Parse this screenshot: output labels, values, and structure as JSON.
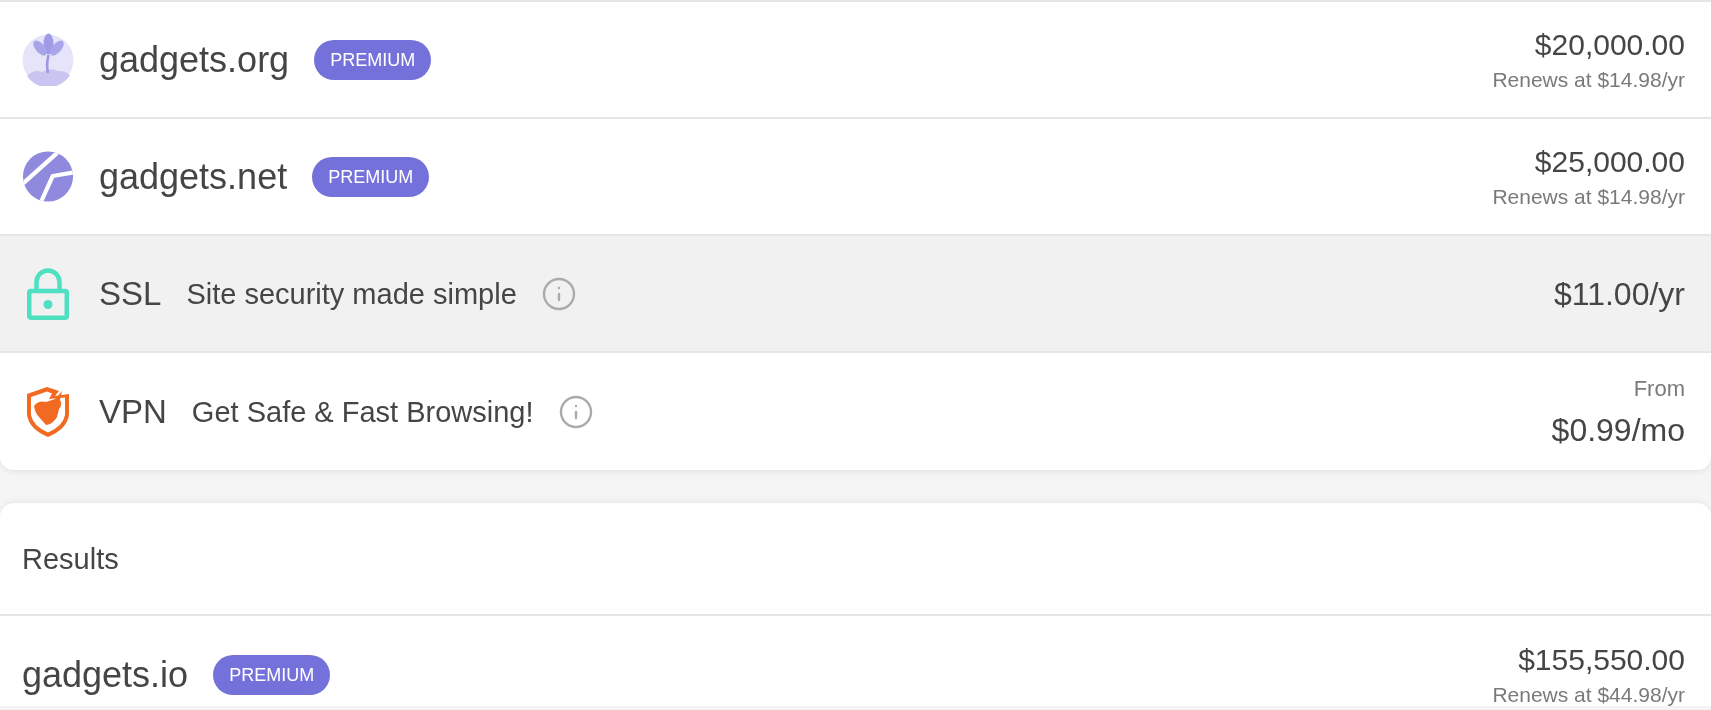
{
  "suggestions": [
    {
      "kind": "domain",
      "name": "gadgets.org",
      "badge": "PREMIUM",
      "price": "$20,000.00",
      "renewal": "Renews at $14.98/yr",
      "highlighted": false
    },
    {
      "kind": "domain",
      "name": "gadgets.net",
      "badge": "PREMIUM",
      "price": "$25,000.00",
      "renewal": "Renews at $14.98/yr",
      "highlighted": false
    },
    {
      "kind": "addon",
      "name": "SSL",
      "tagline": "Site security made simple",
      "price": "$11.00/yr",
      "highlighted": true
    },
    {
      "kind": "addon",
      "name": "VPN",
      "tagline": "Get Safe & Fast Browsing!",
      "price_prefix": "From",
      "price": "$0.99/mo",
      "highlighted": false
    }
  ],
  "results": {
    "title": "Results",
    "rows": [
      {
        "name": "gadgets.io",
        "badge": "PREMIUM",
        "price": "$155,550.00",
        "renewal": "Renews at $44.98/yr"
      }
    ]
  }
}
